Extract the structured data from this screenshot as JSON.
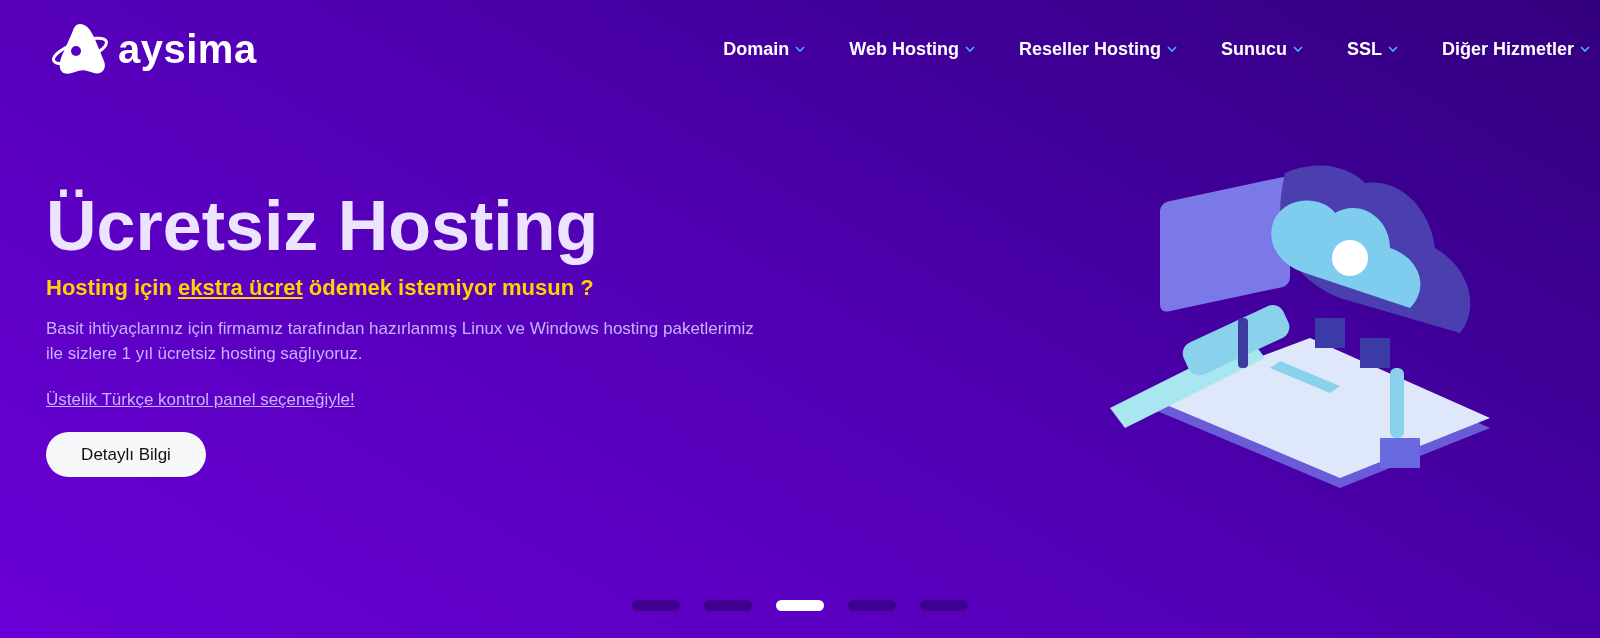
{
  "header": {
    "logo_text": "aysima",
    "nav": [
      {
        "label": "Domain",
        "has_dropdown": true
      },
      {
        "label": "Web Hosting",
        "has_dropdown": true
      },
      {
        "label": "Reseller Hosting",
        "has_dropdown": true
      },
      {
        "label": "Sunucu",
        "has_dropdown": true
      },
      {
        "label": "SSL",
        "has_dropdown": true
      },
      {
        "label": "Diğer Hizmetler",
        "has_dropdown": true
      }
    ]
  },
  "hero": {
    "title": "Ücretsiz Hosting",
    "subtitle": {
      "before": "Hosting için",
      "link": "ekstra ücret",
      "after": "ödemek istemiyor musun ?"
    },
    "description": "Basit ihtiyaçlarınız için firmamız tarafından hazırlanmış Linux ve Windows hosting paketlerimiz ile sizlere 1 yıl ücretsiz hosting sağlıyoruz.",
    "link": "Üstelik Türkçe kontrol panel seçeneğiyle!",
    "button": "Detaylı Bilgi"
  },
  "slider_dots": [
    {
      "selected": false
    },
    {
      "selected": false
    },
    {
      "selected": true
    },
    {
      "selected": false
    },
    {
      "selected": false
    }
  ]
}
